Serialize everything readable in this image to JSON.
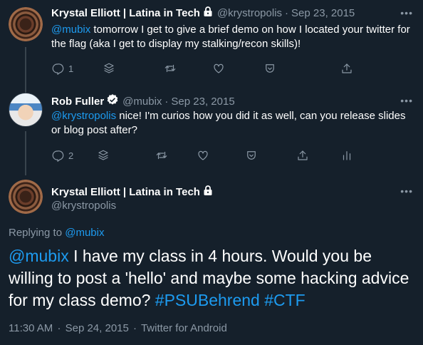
{
  "tweets": [
    {
      "name": "Krystal Elliott | Latina in Tech",
      "handle": "@krystropolis",
      "date": "Sep 23, 2015",
      "mention": "@mubix",
      "text": " tomorrow I get to give a brief demo on how I located your twitter for the flag (aka I get to display my stalking/recon skills)!",
      "reply_count": "1",
      "locked": true
    },
    {
      "name": "Rob Fuller",
      "handle": "@mubix",
      "date": "Sep 23, 2015",
      "mention": "@krystropolis",
      "text": " nice! I'm curios how you did it as well, can you release slides or blog post after?",
      "reply_count": "2",
      "verified": true
    }
  ],
  "focused_tweet": {
    "name": "Krystal Elliott | Latina in Tech",
    "handle": "@krystropolis",
    "replying_label": "Replying to ",
    "replying_to": "@mubix",
    "mention": "@mubix",
    "text": " I have my class in 4 hours.  Would you be willing to post a 'hello' and maybe some hacking advice for my class demo? ",
    "hashtags": [
      "#PSUBehrend",
      "#CTF"
    ],
    "time": "11:30 AM",
    "date": "Sep 24, 2015",
    "source": "Twitter for Android"
  },
  "more_glyph": "•••",
  "separator": "·",
  "colors": {
    "background": "#15202b",
    "accent": "#1d9bf0",
    "muted": "#8b98a5"
  }
}
